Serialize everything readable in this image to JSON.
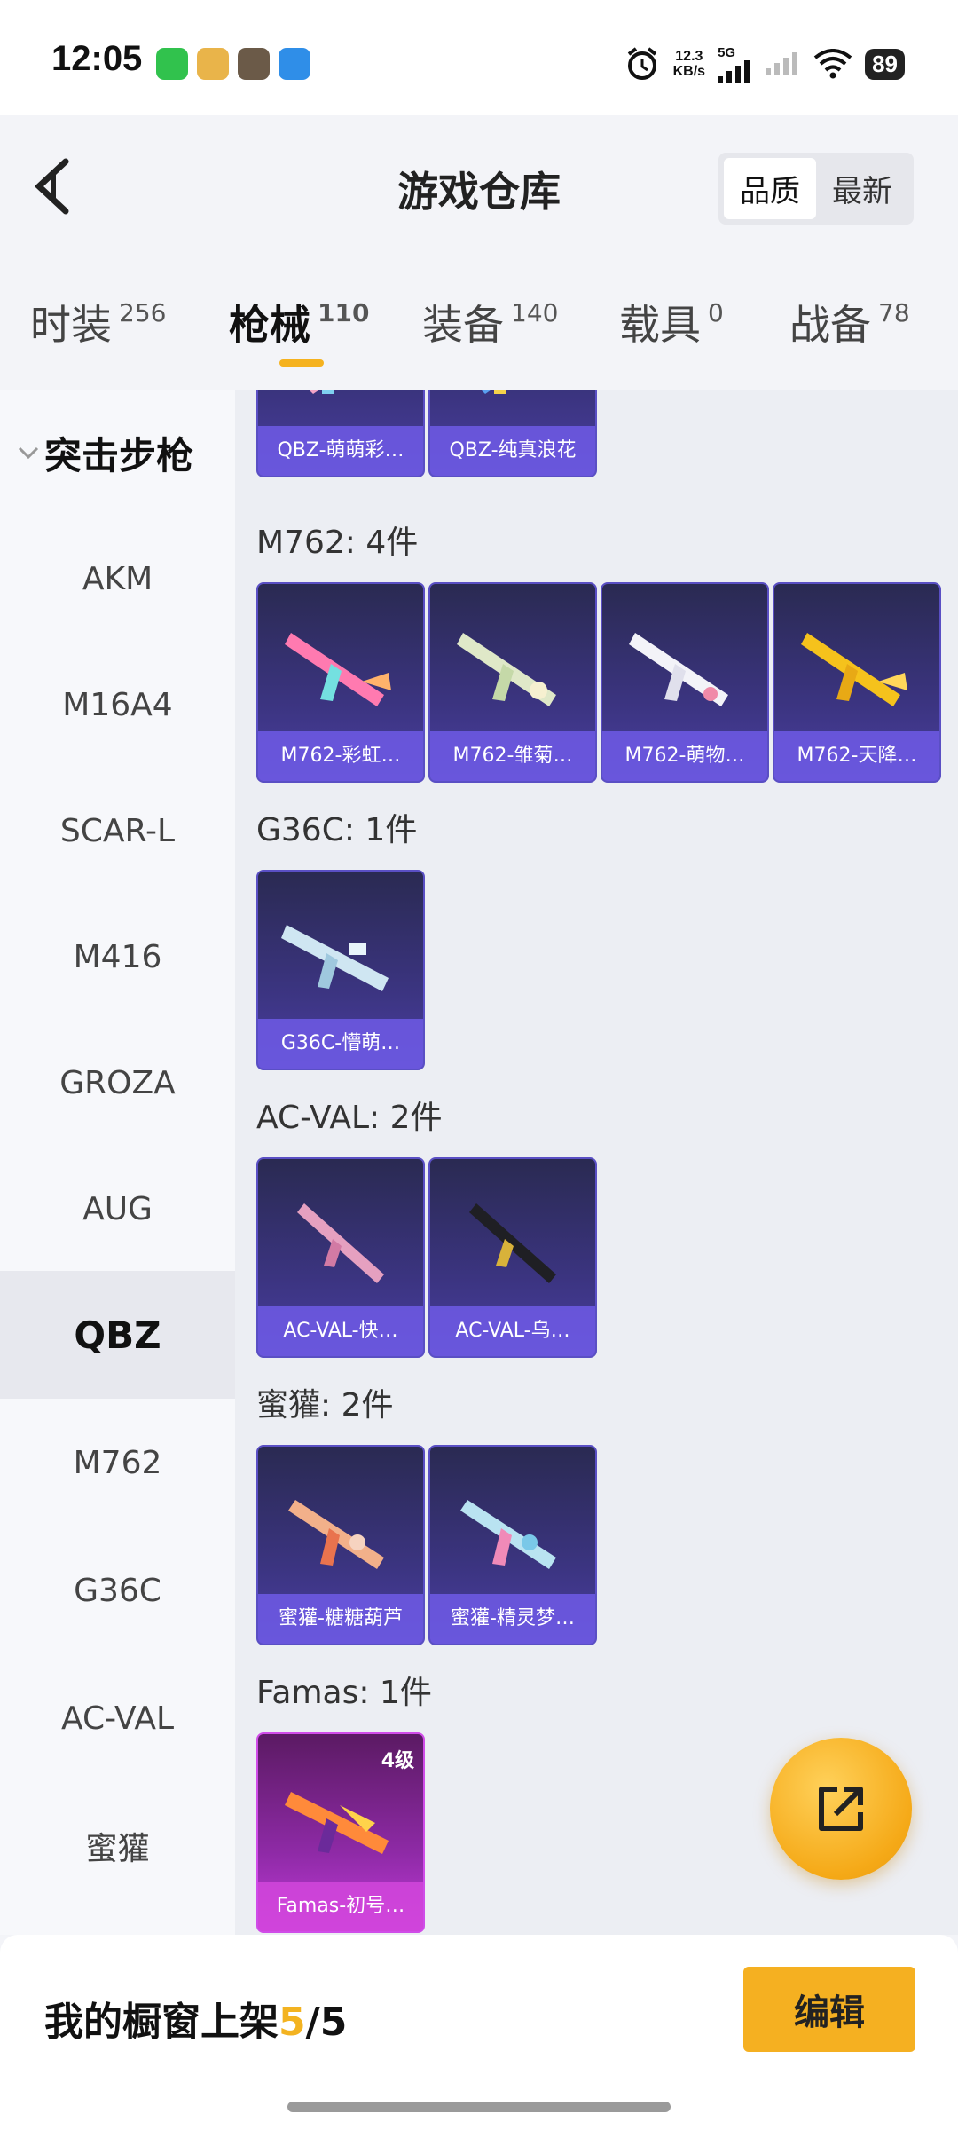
{
  "status_bar": {
    "time": "12:05",
    "net_speed_value": "12.3",
    "net_speed_unit": "KB/s",
    "network_type": "5G",
    "battery": "89",
    "icons": [
      "wechat-icon",
      "game-app-icon",
      "pubg-app-icon",
      "blue-app-icon",
      "alarm-icon",
      "signal-icon",
      "signal-weak-icon",
      "wifi-icon"
    ]
  },
  "header": {
    "title": "游戏仓库",
    "sort_options": [
      "品质",
      "最新"
    ],
    "sort_active": "品质"
  },
  "tabs": [
    {
      "label": "时装",
      "count": "256"
    },
    {
      "label": "枪械",
      "count": "110",
      "active": true
    },
    {
      "label": "装备",
      "count": "140"
    },
    {
      "label": "载具",
      "count": "0"
    },
    {
      "label": "战备",
      "count": "78"
    }
  ],
  "sidebar": {
    "group": "突击步枪",
    "items": [
      "AKM",
      "M16A4",
      "SCAR-L",
      "M416",
      "GROZA",
      "AUG",
      "QBZ",
      "M762",
      "G36C",
      "AC-VAL",
      "蜜獾"
    ],
    "active": "QBZ"
  },
  "content": {
    "top_cards": [
      "QBZ-萌萌彩…",
      "QBZ-纯真浪花"
    ],
    "sections": [
      {
        "title": "M762: 4件",
        "items": [
          "M762-彩虹…",
          "M762-雏菊…",
          "M762-萌物…",
          "M762-天降…"
        ]
      },
      {
        "title": "G36C: 1件",
        "items": [
          "G36C-懵萌…"
        ]
      },
      {
        "title": "AC-VAL: 2件",
        "items": [
          "AC-VAL-快…",
          "AC-VAL-乌…"
        ]
      },
      {
        "title": "蜜獾: 2件",
        "items": [
          "蜜獾-糖糖葫芦",
          "蜜獾-精灵梦…"
        ]
      },
      {
        "title": "Famas: 1件",
        "items": [
          "Famas-初号…"
        ],
        "level": "4级"
      }
    ]
  },
  "bottom": {
    "shelf_label": "我的橱窗上架",
    "shelf_count": "5",
    "shelf_sep": "/",
    "shelf_total": "5",
    "edit_label": "编辑"
  },
  "colors": {
    "accent": "#f5b021",
    "card_purple": "#3b3480",
    "card_pink": "#8e2aa6"
  }
}
